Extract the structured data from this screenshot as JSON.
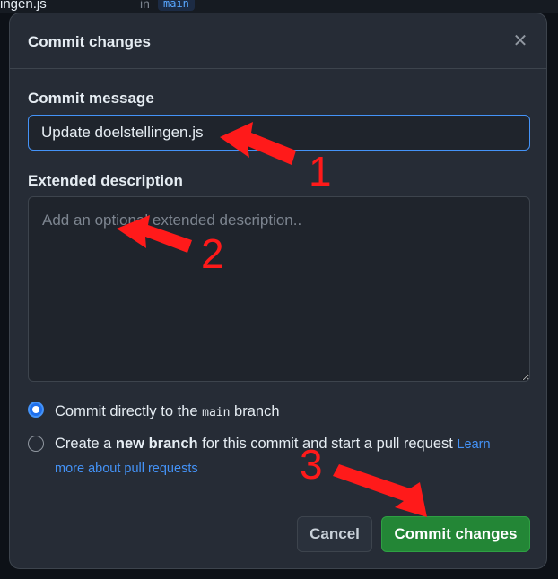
{
  "background": {
    "filename_fragment": "ingen.js",
    "in_label": "in",
    "branch_chip": "main"
  },
  "dialog": {
    "title": "Commit changes",
    "close_icon": "close-icon"
  },
  "commit_message": {
    "label": "Commit message",
    "value": "Update doelstellingen.js"
  },
  "extended_description": {
    "label": "Extended description",
    "placeholder": "Add an optional extended description.."
  },
  "options": {
    "direct": {
      "prefix": "Commit directly to the",
      "branch": "main",
      "suffix": "branch",
      "selected": true
    },
    "new_branch": {
      "prefix": "Create a",
      "bold": "new branch",
      "suffix": "for this commit and start a pull request",
      "link_line1": "Learn",
      "link_line2": "more about pull requests",
      "selected": false
    }
  },
  "footer": {
    "cancel_label": "Cancel",
    "commit_label": "Commit changes"
  },
  "annotations": {
    "step1": "1",
    "step2": "2",
    "step3": "3",
    "color": "#ff1a1a"
  },
  "colors": {
    "accent": "#4493f8",
    "primary_button": "#238636",
    "dialog_bg": "#262c36"
  }
}
